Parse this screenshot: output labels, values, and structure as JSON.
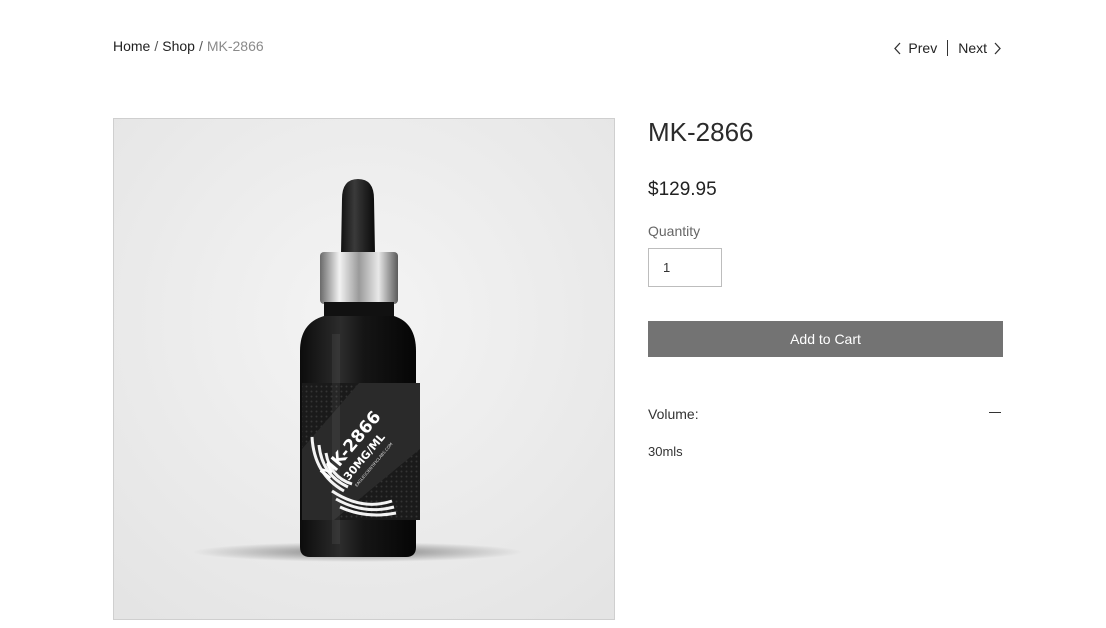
{
  "breadcrumb": {
    "home": "Home",
    "sep1": "/",
    "shop": "Shop",
    "sep2": "/",
    "current": "MK-2866"
  },
  "pager": {
    "prev": "Prev",
    "next": "Next"
  },
  "product": {
    "title": "MK-2866",
    "price": "$129.95",
    "quantity_label": "Quantity",
    "quantity_value": "1",
    "add_to_cart": "Add to Cart",
    "info_title": "Volume:",
    "info_body": "30mls",
    "image_label": {
      "line1": "MK-2866",
      "line2": "30MG/ML",
      "line3": "EAGLESCIENTIFICLABS.COM"
    }
  },
  "colors": {
    "button": "#737373",
    "border": "#cfcfcf",
    "muted": "#8a8a8a"
  },
  "icons": {
    "prev": "chevron-left-icon",
    "next": "chevron-right-icon",
    "collapse": "minus-icon"
  }
}
